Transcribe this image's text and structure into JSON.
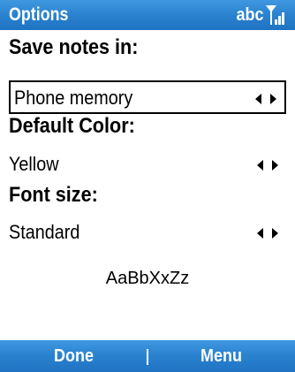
{
  "titlebar": {
    "title": "Options",
    "input_mode": "abc",
    "signal_icon": "signal-strength-icon"
  },
  "fields": {
    "save_notes": {
      "label": "Save notes in:",
      "value": "Phone memory"
    },
    "default_color": {
      "label": "Default Color:",
      "value": "Yellow"
    },
    "font_size": {
      "label": "Font size:",
      "value": "Standard"
    }
  },
  "preview": {
    "sample_text": "AaBbXxZz"
  },
  "softkeys": {
    "left_label": "Done",
    "right_label": "Menu"
  },
  "colors": {
    "bar_blue": "#2a82cf",
    "text": "#000000",
    "background": "#ffffff"
  }
}
